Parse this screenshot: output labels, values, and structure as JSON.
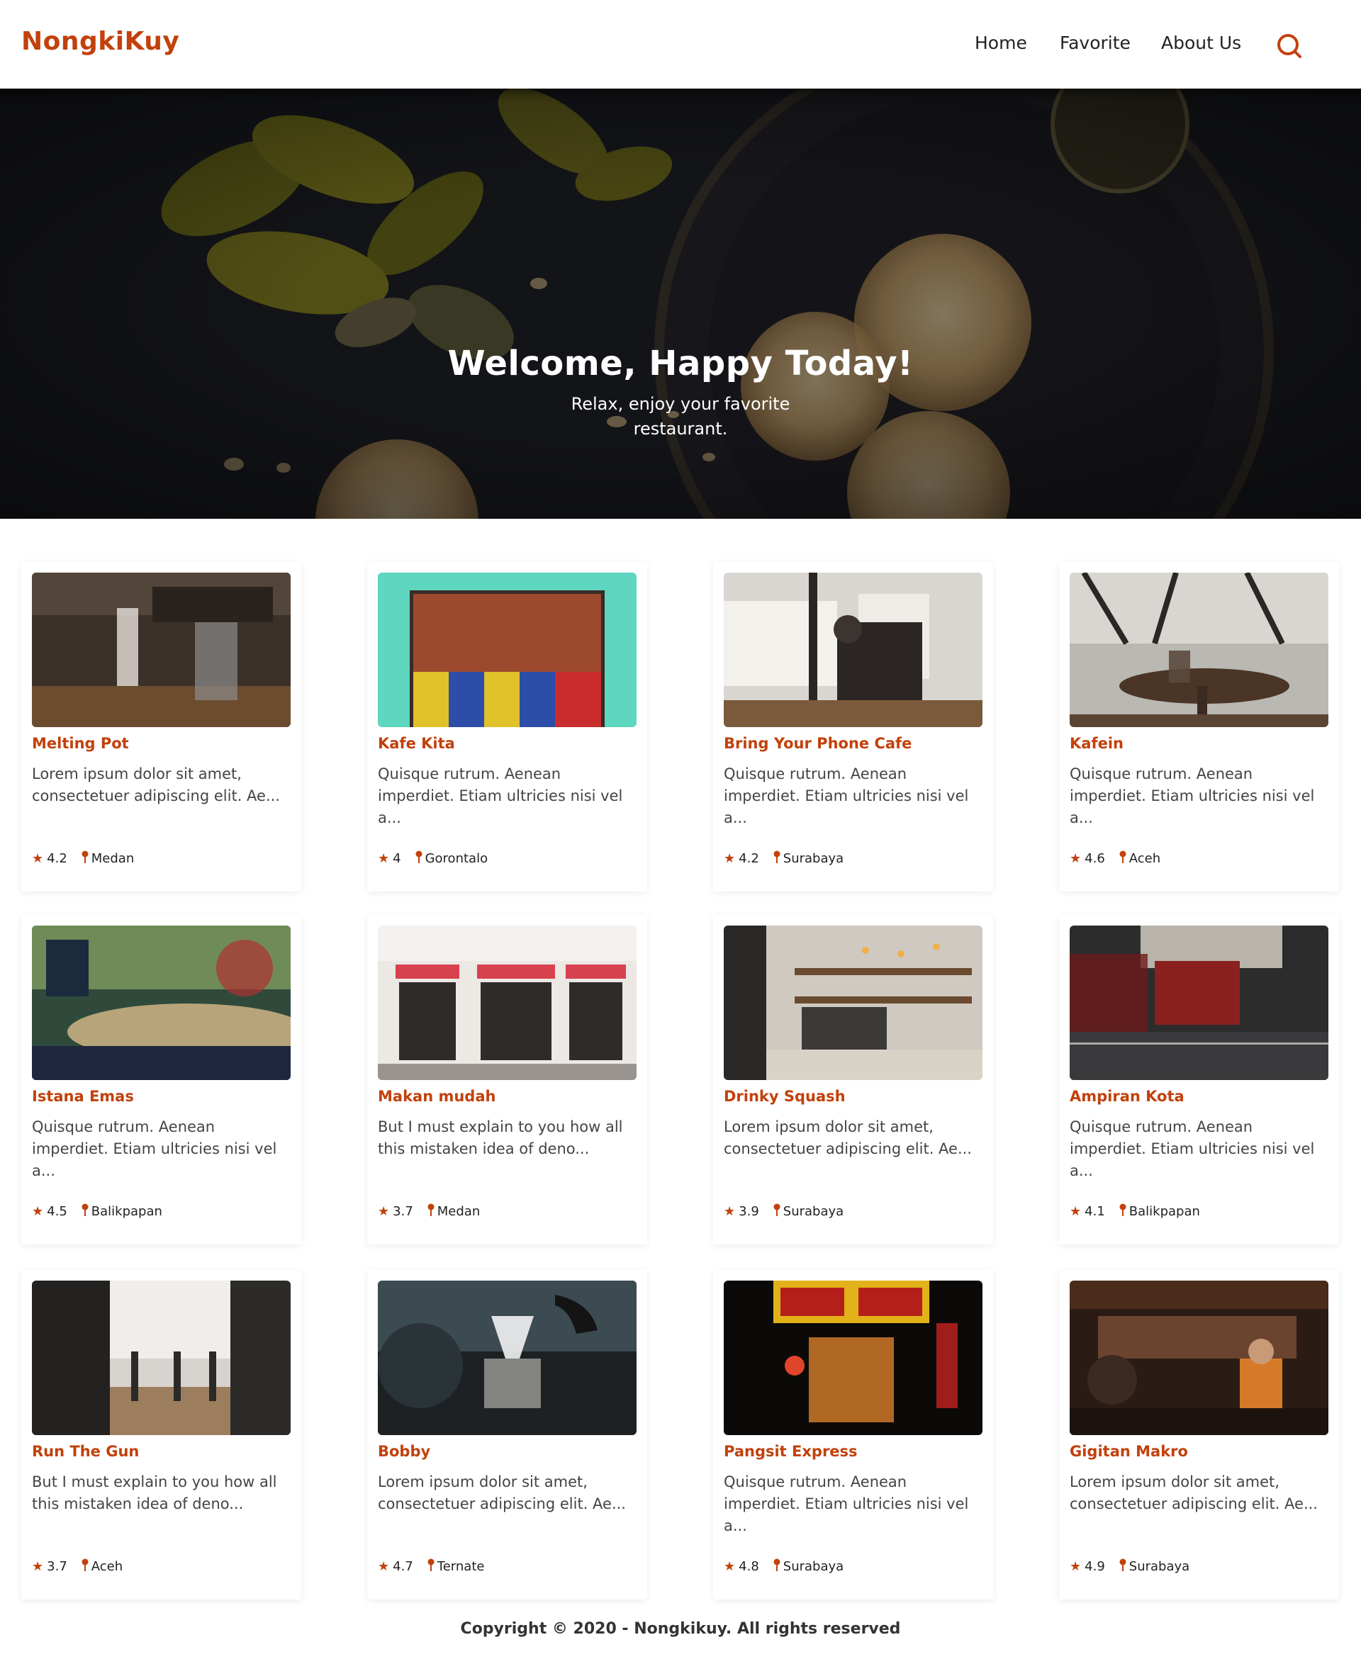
{
  "header": {
    "brand": "NongkiKuy",
    "nav": [
      {
        "label": "Home"
      },
      {
        "label": "Favorite"
      },
      {
        "label": "About Us"
      }
    ],
    "search_icon": "search-icon",
    "accent_color": "#c2410c"
  },
  "hero": {
    "title": "Welcome, Happy Today!",
    "subtitle": "Relax, enjoy your favorite restaurant."
  },
  "restaurants": [
    {
      "name": "Melting Pot",
      "description": "Lorem ipsum dolor sit amet, consectetuer adipiscing elit. Ae...",
      "rating": "4.2",
      "city": "Medan"
    },
    {
      "name": "Kafe Kita",
      "description": "Quisque rutrum. Aenean imperdiet. Etiam ultricies nisi vel a...",
      "rating": "4",
      "city": "Gorontalo"
    },
    {
      "name": "Bring Your Phone Cafe",
      "description": "Quisque rutrum. Aenean imperdiet. Etiam ultricies nisi vel a...",
      "rating": "4.2",
      "city": "Surabaya"
    },
    {
      "name": "Kafein",
      "description": "Quisque rutrum. Aenean imperdiet. Etiam ultricies nisi vel a...",
      "rating": "4.6",
      "city": "Aceh"
    },
    {
      "name": "Istana Emas",
      "description": "Quisque rutrum. Aenean imperdiet. Etiam ultricies nisi vel a...",
      "rating": "4.5",
      "city": "Balikpapan"
    },
    {
      "name": "Makan mudah",
      "description": "But I must explain to you how all this mistaken idea of deno...",
      "rating": "3.7",
      "city": "Medan"
    },
    {
      "name": "Drinky Squash",
      "description": "Lorem ipsum dolor sit amet, consectetuer adipiscing elit. Ae...",
      "rating": "3.9",
      "city": "Surabaya"
    },
    {
      "name": "Ampiran Kota",
      "description": "Quisque rutrum. Aenean imperdiet. Etiam ultricies nisi vel a...",
      "rating": "4.1",
      "city": "Balikpapan"
    },
    {
      "name": "Run The Gun",
      "description": "But I must explain to you how all this mistaken idea of deno...",
      "rating": "3.7",
      "city": "Aceh"
    },
    {
      "name": "Bobby",
      "description": "Lorem ipsum dolor sit amet, consectetuer adipiscing elit. Ae...",
      "rating": "4.7",
      "city": "Ternate"
    },
    {
      "name": "Pangsit Express",
      "description": "Quisque rutrum. Aenean imperdiet. Etiam ultricies nisi vel a...",
      "rating": "4.8",
      "city": "Surabaya"
    },
    {
      "name": "Gigitan Makro",
      "description": "Lorem ipsum dolor sit amet, consectetuer adipiscing elit. Ae...",
      "rating": "4.9",
      "city": "Surabaya"
    }
  ],
  "footer": {
    "copyright": "Copyright © 2020 - Nongkikuy. All rights reserved"
  }
}
